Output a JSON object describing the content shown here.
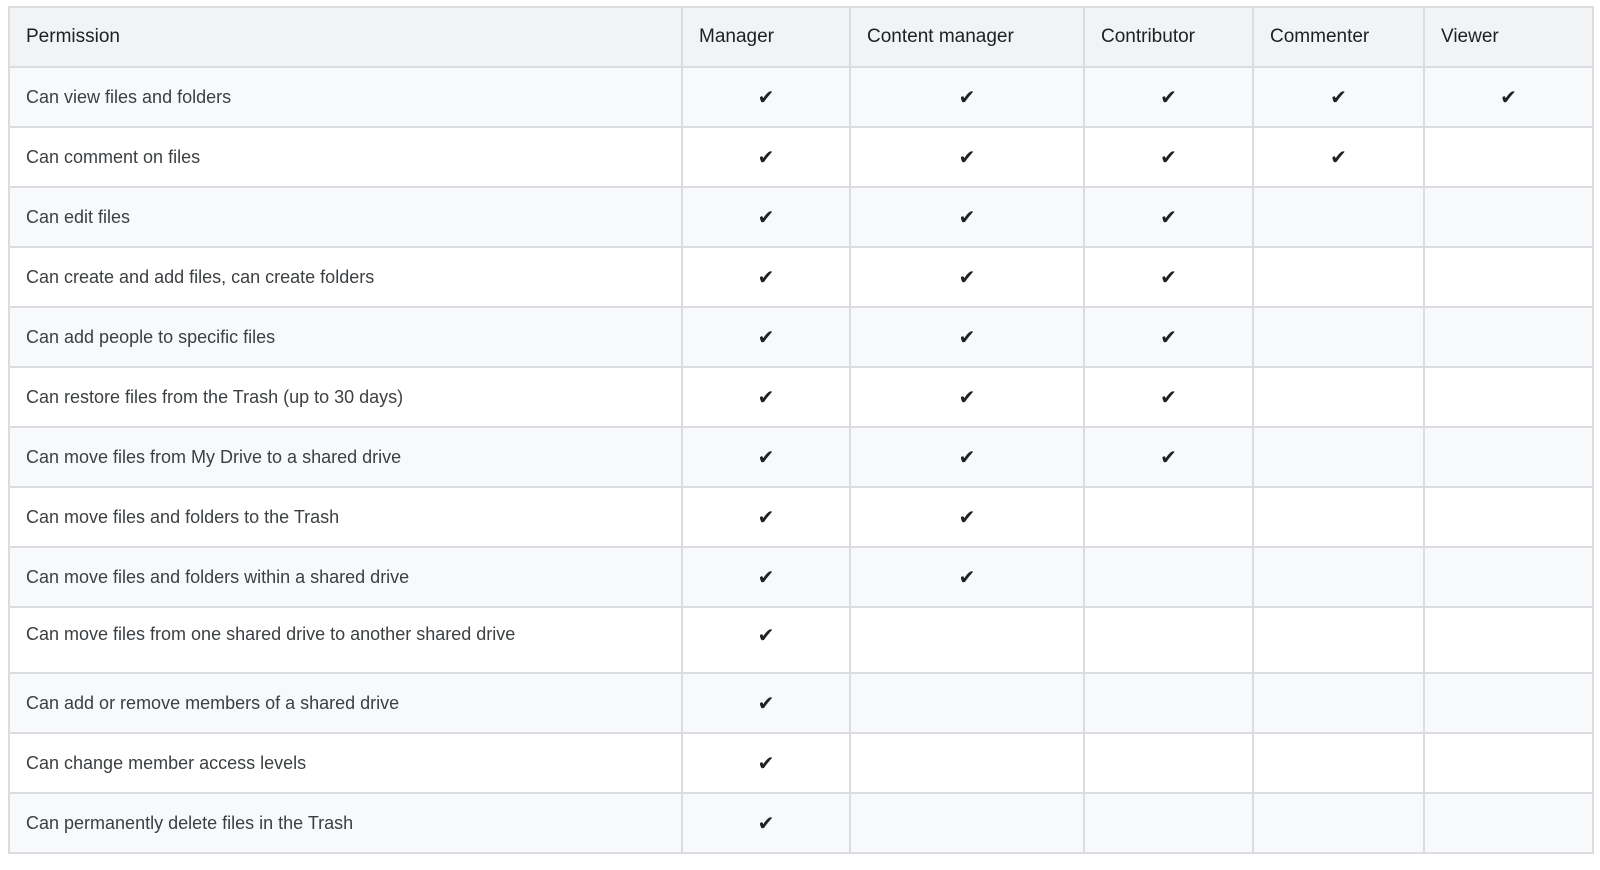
{
  "table": {
    "headers": [
      "Permission",
      "Manager",
      "Content manager",
      "Contributor",
      "Commenter",
      "Viewer"
    ],
    "check_symbol": "✔",
    "check_icon": "checkmark-icon",
    "rows": [
      {
        "permission": "Can view files and folders",
        "access": [
          true,
          true,
          true,
          true,
          true
        ]
      },
      {
        "permission": "Can comment on files",
        "access": [
          true,
          true,
          true,
          true,
          false
        ]
      },
      {
        "permission": "Can edit files",
        "access": [
          true,
          true,
          true,
          false,
          false
        ]
      },
      {
        "permission": "Can create and add files, can create folders",
        "access": [
          true,
          true,
          true,
          false,
          false
        ]
      },
      {
        "permission": "Can add people to specific files",
        "access": [
          true,
          true,
          true,
          false,
          false
        ]
      },
      {
        "permission": "Can restore files from the Trash (up to 30 days)",
        "access": [
          true,
          true,
          true,
          false,
          false
        ]
      },
      {
        "permission": "Can move files from My Drive to a shared drive",
        "access": [
          true,
          true,
          true,
          false,
          false
        ]
      },
      {
        "permission": "Can move files and folders to the Trash",
        "access": [
          true,
          true,
          false,
          false,
          false
        ]
      },
      {
        "permission": "Can move files and folders within a shared drive",
        "access": [
          true,
          true,
          false,
          false,
          false
        ]
      },
      {
        "permission": "Can move files from one shared drive to another shared drive",
        "access": [
          true,
          false,
          false,
          false,
          false
        ]
      },
      {
        "permission": "Can add or remove members of a shared drive",
        "access": [
          true,
          false,
          false,
          false,
          false
        ]
      },
      {
        "permission": "Can change member access levels",
        "access": [
          true,
          false,
          false,
          false,
          false
        ]
      },
      {
        "permission": "Can permanently delete files in the Trash",
        "access": [
          true,
          false,
          false,
          false,
          false
        ]
      }
    ]
  }
}
